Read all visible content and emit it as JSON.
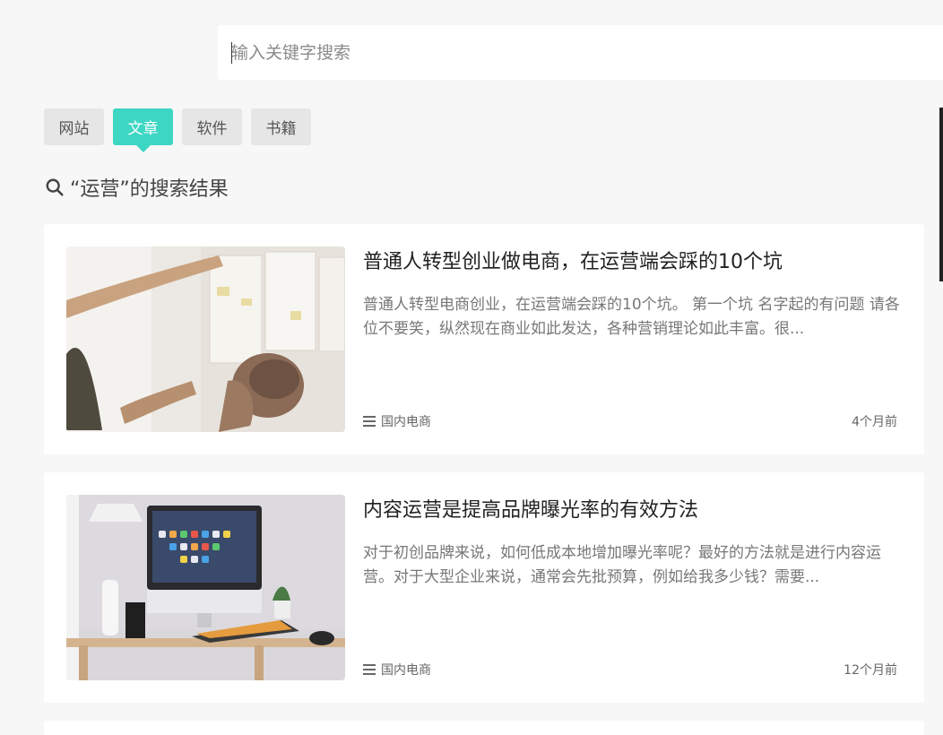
{
  "search": {
    "placeholder": "输入关键字搜索"
  },
  "tabs": [
    {
      "label": "网站"
    },
    {
      "label": "文章"
    },
    {
      "label": "软件"
    },
    {
      "label": "书籍"
    }
  ],
  "active_tab": "文章",
  "result_heading": "“运营”的搜索结果",
  "articles": [
    {
      "title": "普通人转型创业做电商，在运营端会踩的10个坑",
      "excerpt": "普通人转型电商创业，在运营端会踩的10个坑。 第一个坑 名字起的有问题 请各位不要笑，纵然现在商业如此发达，各种营销理论如此丰富。很...",
      "category": "国内电商",
      "time": "4个月前"
    },
    {
      "title": "内容运营是提高品牌曝光率的有效方法",
      "excerpt": "对于初创品牌来说，如何低成本地增加曝光率呢？最好的方法就是进行内容运营。对于大型企业来说，通常会先批预算，例如给我多少钱？需要...",
      "category": "国内电商",
      "time": "12个月前"
    }
  ],
  "colors": {
    "accent": "#3dd6c3",
    "background": "#f7f7f7",
    "card": "#ffffff"
  }
}
